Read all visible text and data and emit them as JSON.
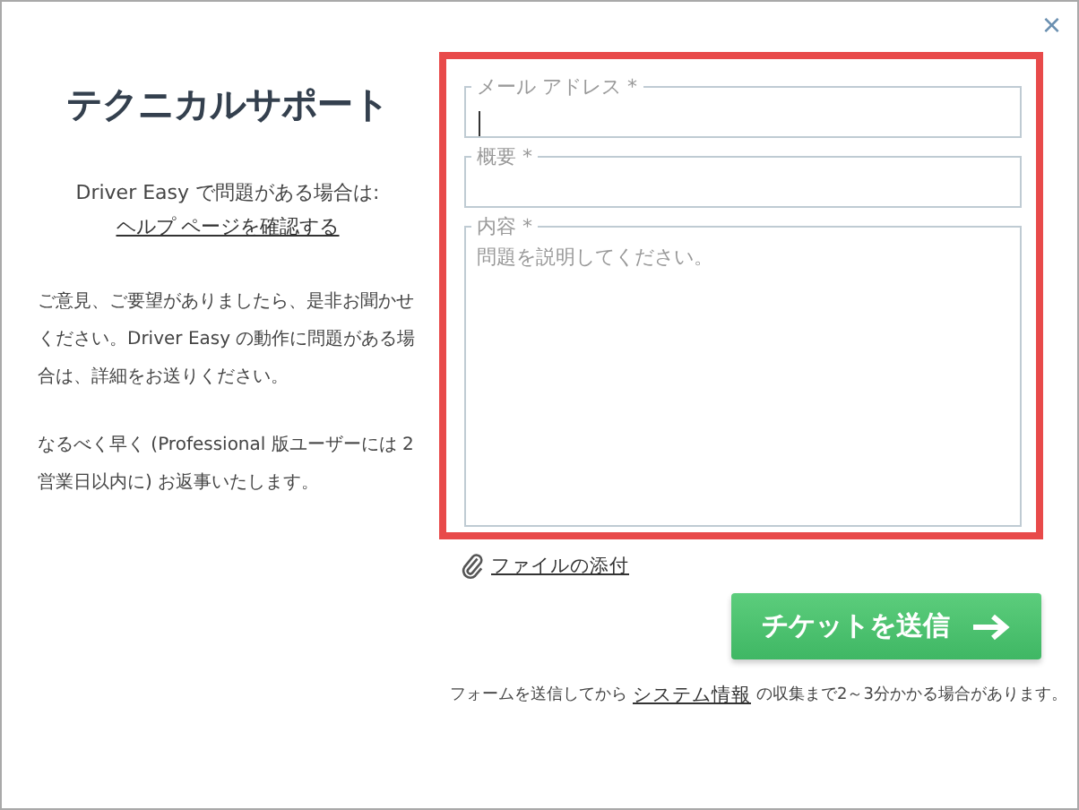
{
  "close": "×",
  "left": {
    "title": "テクニカルサポート",
    "intro": "Driver Easy で問題がある場合は:",
    "help_link": "ヘルプ ページを確認する",
    "paragraphs": [
      "ご意見、ご要望がありましたら、是非お聞かせください。Driver Easy の動作に問題がある場合は、詳細をお送りください。",
      "なるべく早く (Professional 版ユーザーには 2 営業日以内に) お返事いたします。"
    ]
  },
  "form": {
    "fields": [
      {
        "kind": "input",
        "label": "メール アドレス *",
        "focused": true
      },
      {
        "kind": "input",
        "label": "概要 *",
        "focused": false
      },
      {
        "kind": "textarea",
        "label": "内容 *",
        "placeholder": "問題を説明してください。",
        "focused": false
      }
    ],
    "attach_link": "ファイルの添付",
    "submit": "チケットを送信",
    "footer_before": "フォームを送信してから",
    "footer_link": "システム情報",
    "footer_after": "の収集まで2～3分かかる場合があります。"
  }
}
